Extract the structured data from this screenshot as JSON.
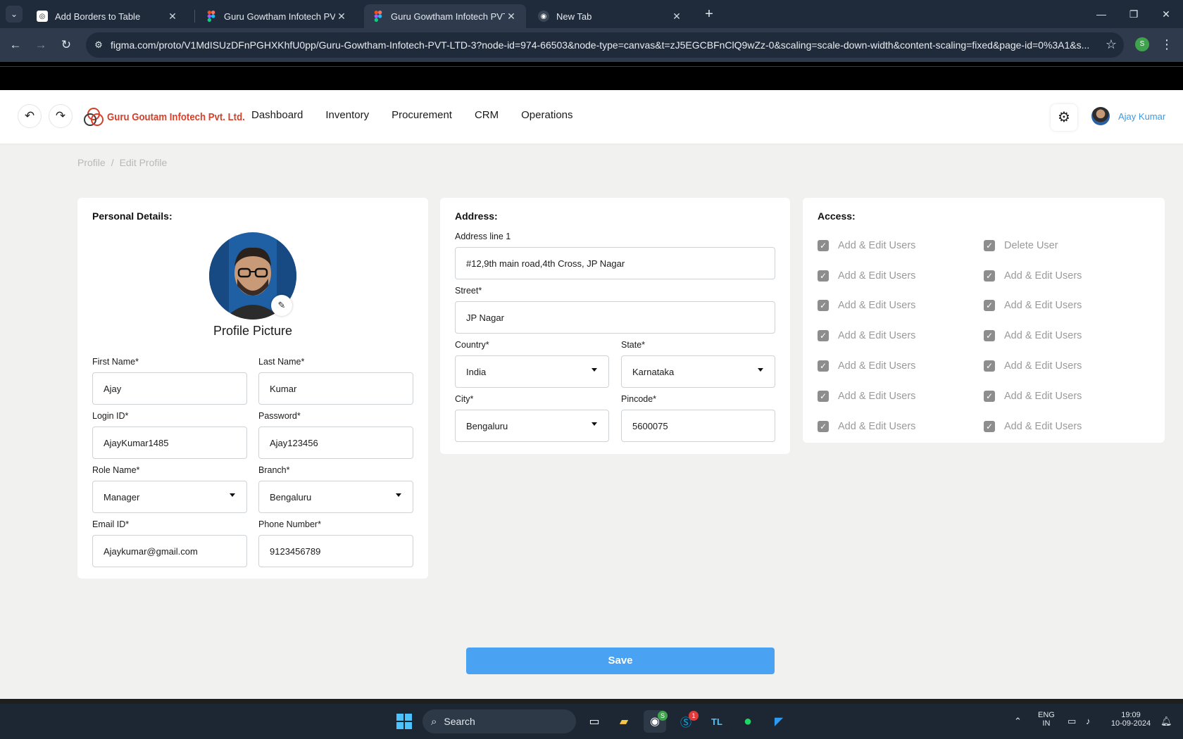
{
  "browser": {
    "tabs": [
      {
        "title": "Add Borders to Table",
        "icon": "chatgpt-icon",
        "active": false
      },
      {
        "title": "Guru Gowtham Infotech PVT LTD",
        "icon": "figma-icon",
        "active": false
      },
      {
        "title": "Guru Gowtham Infotech PVT LTD",
        "icon": "figma-icon",
        "active": true
      },
      {
        "title": "New Tab",
        "icon": "chrome-icon",
        "active": false
      }
    ],
    "url": "figma.com/proto/V1MdISUzDFnPGHXKhfU0pp/Guru-Gowtham-Infotech-PVT-LTD-3?node-id=974-66503&node-type=canvas&t=zJ5EGCBFnClQ9wZz-0&scaling=scale-down-width&content-scaling=fixed&page-id=0%3A1&s...",
    "profile_initial": "S"
  },
  "header": {
    "logo_text": "Guru Goutam Infotech Pvt. Ltd.",
    "nav": [
      "Dashboard",
      "Inventory",
      "Procurement",
      "CRM",
      "Operations"
    ],
    "user_name": "Ajay Kumar"
  },
  "breadcrumb": {
    "root": "Profile",
    "separator": "/",
    "current": "Edit Profile"
  },
  "personal": {
    "title": "Personal Details:",
    "picture_label": "Profile Picture",
    "first_name": {
      "label": "First Name*",
      "value": "Ajay"
    },
    "last_name": {
      "label": "Last Name*",
      "value": "Kumar"
    },
    "login_id": {
      "label": "Login ID*",
      "value": "AjayKumar1485"
    },
    "password": {
      "label": "Password*",
      "value": "Ajay123456"
    },
    "role": {
      "label": "Role Name*",
      "value": "Manager"
    },
    "branch": {
      "label": "Branch*",
      "value": "Bengaluru"
    },
    "email": {
      "label": "Email ID*",
      "value": "Ajaykumar@gmail.com"
    },
    "phone": {
      "label": "Phone Number*",
      "value": "9123456789"
    }
  },
  "address": {
    "title": "Address:",
    "line1": {
      "label": "Address line 1",
      "value": "#12,9th main road,4th Cross, JP Nagar"
    },
    "street": {
      "label": "Street*",
      "value": "JP Nagar"
    },
    "country": {
      "label": "Country*",
      "value": "India"
    },
    "state": {
      "label": "State*",
      "value": "Karnataka"
    },
    "city": {
      "label": "City*",
      "value": "Bengaluru"
    },
    "pincode": {
      "label": "Pincode*",
      "value": "5600075"
    }
  },
  "access": {
    "title": "Access:",
    "left": [
      "Add & Edit Users",
      "Add & Edit Users",
      "Add & Edit Users",
      "Add & Edit Users",
      "Add & Edit Users",
      "Add & Edit Users",
      "Add & Edit Users"
    ],
    "right": [
      "Delete User",
      "Add & Edit Users",
      "Add & Edit Users",
      "Add & Edit Users",
      "Add & Edit Users",
      "Add & Edit Users",
      "Add & Edit Users"
    ]
  },
  "save_label": "Save",
  "taskbar": {
    "search_label": "Search",
    "lang_top": "ENG",
    "lang_bottom": "IN",
    "time": "19:09",
    "date": "10-09-2024",
    "skype_badge": "1",
    "chrome_badge": "S"
  },
  "colors": {
    "accent": "#4aa3f2",
    "brand": "#d6402a",
    "user_link": "#3a9ae6"
  }
}
